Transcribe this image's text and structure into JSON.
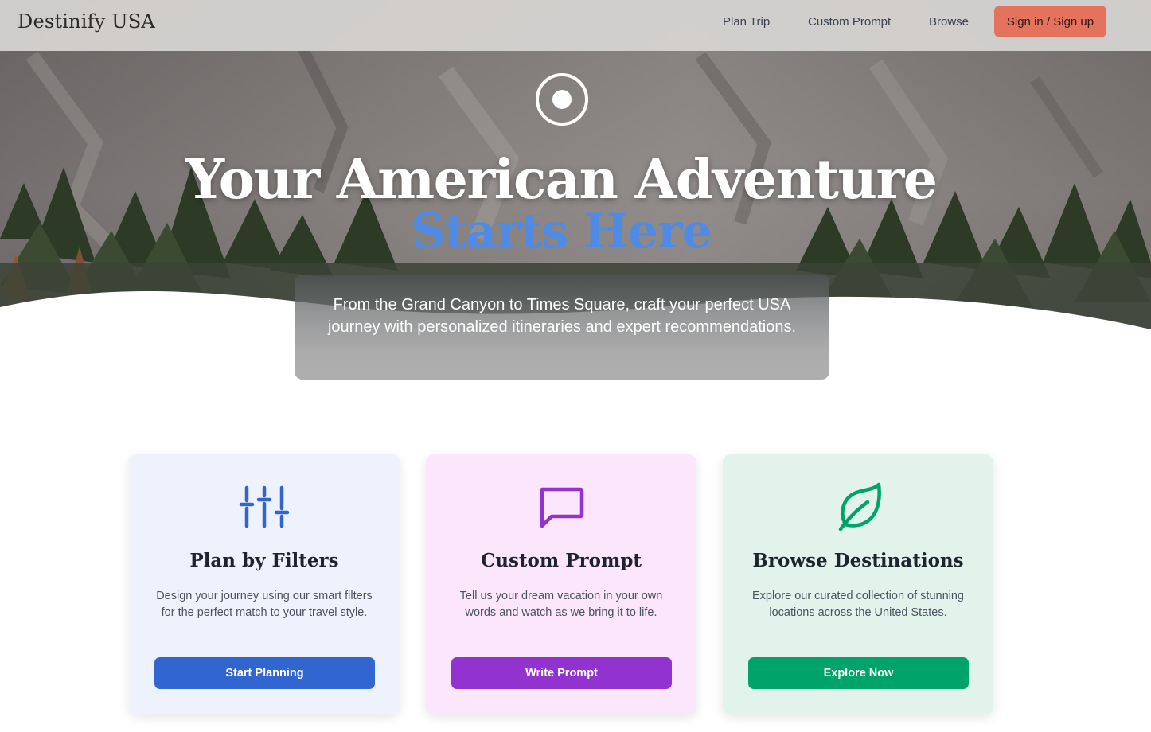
{
  "nav": {
    "brand": "Destinify USA",
    "links": [
      "Plan Trip",
      "Custom Prompt",
      "Browse"
    ],
    "signin_label": "Sign in / Sign up"
  },
  "hero": {
    "icon": "target-icon",
    "title": "Your American Adventure",
    "subtitle": "Starts Here",
    "description": "From the Grand Canyon to Times Square, craft your perfect USA journey with personalized itineraries and expert recommendations."
  },
  "cards": [
    {
      "icon": "sliders-icon",
      "title": "Plan by Filters",
      "text": "Design your journey using our smart filters for the perfect match to your travel style.",
      "button": "Start Planning",
      "color": "#3165d0"
    },
    {
      "icon": "chat-bubble-icon",
      "title": "Custom Prompt",
      "text": "Tell us your dream vacation in your own words and watch as we bring it to life.",
      "button": "Write Prompt",
      "color": "#9333cf"
    },
    {
      "icon": "leaf-icon",
      "title": "Browse Destinations",
      "text": "Explore our curated collection of stunning locations across the United States.",
      "button": "Explore Now",
      "color": "#00a46a"
    }
  ],
  "colors": {
    "accent_blue": "#4f8ae4",
    "signin_coral": "#e5725c"
  }
}
